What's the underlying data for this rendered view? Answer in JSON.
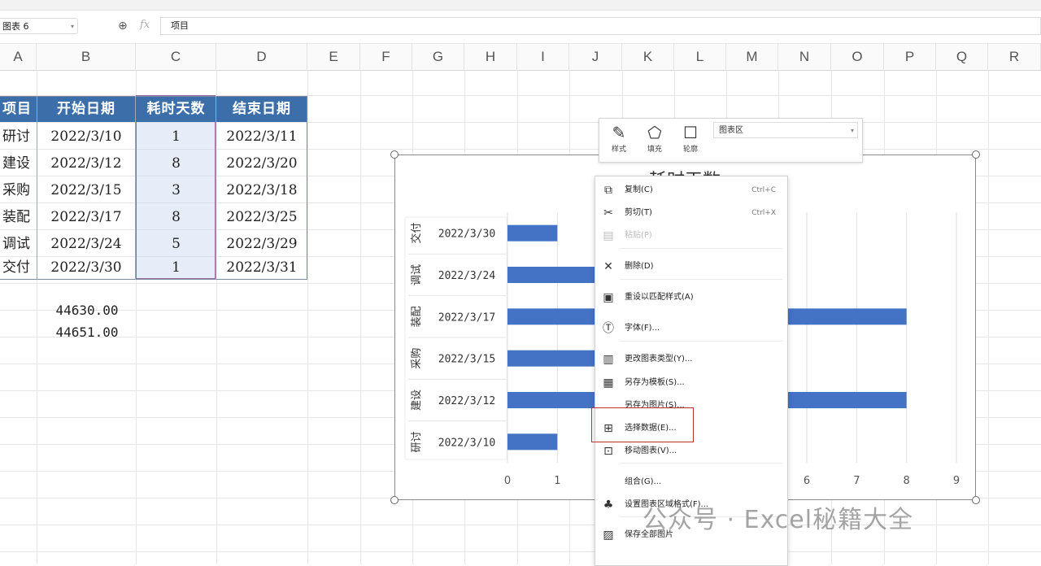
{
  "formula_bar": {
    "name_box": "图表 6",
    "formula": "项目"
  },
  "columns": [
    "A",
    "B",
    "C",
    "D",
    "E",
    "F",
    "G",
    "H",
    "I",
    "J",
    "K",
    "L",
    "M",
    "N",
    "O",
    "P",
    "Q",
    "R"
  ],
  "table": {
    "headers": [
      "项目",
      "开始日期",
      "耗时天数",
      "结束日期"
    ],
    "rows": [
      [
        "研讨",
        "2022/3/10",
        "1",
        "2022/3/11"
      ],
      [
        "建设",
        "2022/3/12",
        "8",
        "2022/3/20"
      ],
      [
        "采购",
        "2022/3/15",
        "3",
        "2022/3/18"
      ],
      [
        "装配",
        "2022/3/17",
        "8",
        "2022/3/25"
      ],
      [
        "调试",
        "2022/3/24",
        "5",
        "2022/3/29"
      ],
      [
        "交付",
        "2022/3/30",
        "1",
        "2022/3/31"
      ]
    ]
  },
  "extra_values": [
    "44630.00",
    "44651.00"
  ],
  "mini_toolbar": {
    "style_label": "样式",
    "fill_label": "填充",
    "outline_label": "轮廓",
    "element_select": "图表区"
  },
  "context_menu": [
    {
      "label": "复制(C)",
      "shortcut": "Ctrl+C",
      "icon": "copy-icon",
      "glyph": "⧉",
      "disabled": false
    },
    {
      "label": "剪切(T)",
      "shortcut": "Ctrl+X",
      "icon": "scissors-icon",
      "glyph": "✂",
      "disabled": false
    },
    {
      "label": "粘贴(P)",
      "shortcut": "",
      "icon": "paste-icon",
      "glyph": "▤",
      "disabled": true
    },
    {
      "label": "删除(D)",
      "shortcut": "",
      "icon": "delete-icon",
      "glyph": "✕",
      "disabled": false
    },
    {
      "label": "重设以匹配样式(A)",
      "shortcut": "",
      "icon": "reset-style-icon",
      "glyph": "▣",
      "disabled": false
    },
    {
      "label": "字体(F)...",
      "shortcut": "",
      "icon": "font-icon",
      "glyph": "Ⓣ",
      "disabled": false
    },
    {
      "label": "更改图表类型(Y)...",
      "shortcut": "",
      "icon": "chart-type-icon",
      "glyph": "▥",
      "disabled": false
    },
    {
      "label": "另存为模板(S)...",
      "shortcut": "",
      "icon": "save-template-icon",
      "glyph": "▦",
      "disabled": false
    },
    {
      "label": "另存为图片(S)...",
      "shortcut": "",
      "icon": "save-image-icon",
      "glyph": "",
      "disabled": false
    },
    {
      "label": "选择数据(E)...",
      "shortcut": "",
      "icon": "select-data-icon",
      "glyph": "⊞",
      "disabled": false
    },
    {
      "label": "移动图表(V)...",
      "shortcut": "",
      "icon": "move-chart-icon",
      "glyph": "⊡",
      "disabled": false
    },
    {
      "label": "组合(G)...",
      "shortcut": "",
      "icon": "group-icon",
      "glyph": "",
      "disabled": false
    },
    {
      "label": "设置图表区域格式(F)...",
      "shortcut": "",
      "icon": "format-area-icon",
      "glyph": "♣",
      "disabled": false
    },
    {
      "label": "保存全部图片",
      "shortcut": "",
      "icon": "save-all-images-icon",
      "glyph": "▨",
      "disabled": false
    }
  ],
  "watermark": "公众号 · Excel秘籍大全",
  "chart_data": {
    "type": "bar",
    "orientation": "horizontal",
    "title": "耗时天数",
    "categories": [
      "2022/3/10",
      "2022/3/12",
      "2022/3/15",
      "2022/3/17",
      "2022/3/24",
      "2022/3/30"
    ],
    "category_group_labels": [
      "研讨",
      "建设",
      "采购",
      "装配",
      "调试",
      "交付"
    ],
    "series": [
      {
        "name": "耗时天数",
        "values": [
          1,
          8,
          3,
          8,
          5,
          1
        ],
        "color": "#4472c4"
      }
    ],
    "x_ticks": [
      "0",
      "1",
      "2",
      "3",
      "4",
      "5",
      "6",
      "7",
      "8",
      "9"
    ],
    "xlim": [
      0,
      9
    ],
    "grid": true
  }
}
